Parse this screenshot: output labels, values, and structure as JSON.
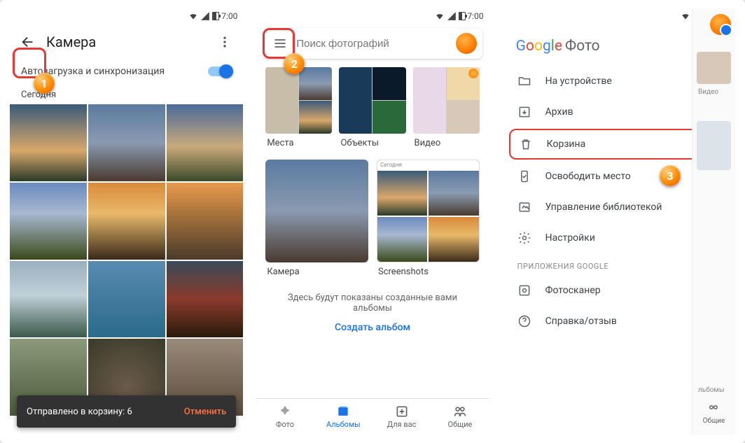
{
  "status": {
    "time": "7:00"
  },
  "screen1": {
    "title": "Камера",
    "sync_label": "Автозагрузка и синхронизация",
    "section": "Сегодня",
    "snackbar_text": "Отправлено в корзину: 6",
    "snackbar_action": "Отменить"
  },
  "screen2": {
    "search_placeholder": "Поиск фотографий",
    "categories": [
      {
        "label": "Места"
      },
      {
        "label": "Объекты"
      },
      {
        "label": "Видео"
      }
    ],
    "albums": [
      {
        "label": "Камера"
      },
      {
        "label": "Screenshots",
        "header": "Сегодня"
      }
    ],
    "hint": "Здесь будут показаны созданные вами альбомы",
    "create": "Создать альбом",
    "nav": [
      {
        "label": "Фото"
      },
      {
        "label": "Альбомы"
      },
      {
        "label": "Для вас"
      },
      {
        "label": "Общие"
      }
    ]
  },
  "screen3": {
    "brand_suffix": "Фото",
    "menu": [
      {
        "label": "На устройстве"
      },
      {
        "label": "Архив"
      },
      {
        "label": "Корзина"
      },
      {
        "label": "Освободить место"
      },
      {
        "label": "Управление библиотекой"
      },
      {
        "label": "Настройки"
      }
    ],
    "section": "ПРИЛОЖЕНИЯ GOOGLE",
    "extra": [
      {
        "label": "Фотосканер"
      },
      {
        "label": "Справка/отзыв"
      }
    ],
    "peek_labels": {
      "video": "Видео",
      "shared": "Общие"
    }
  },
  "callouts": {
    "one": "1",
    "two": "2",
    "three": "3"
  }
}
